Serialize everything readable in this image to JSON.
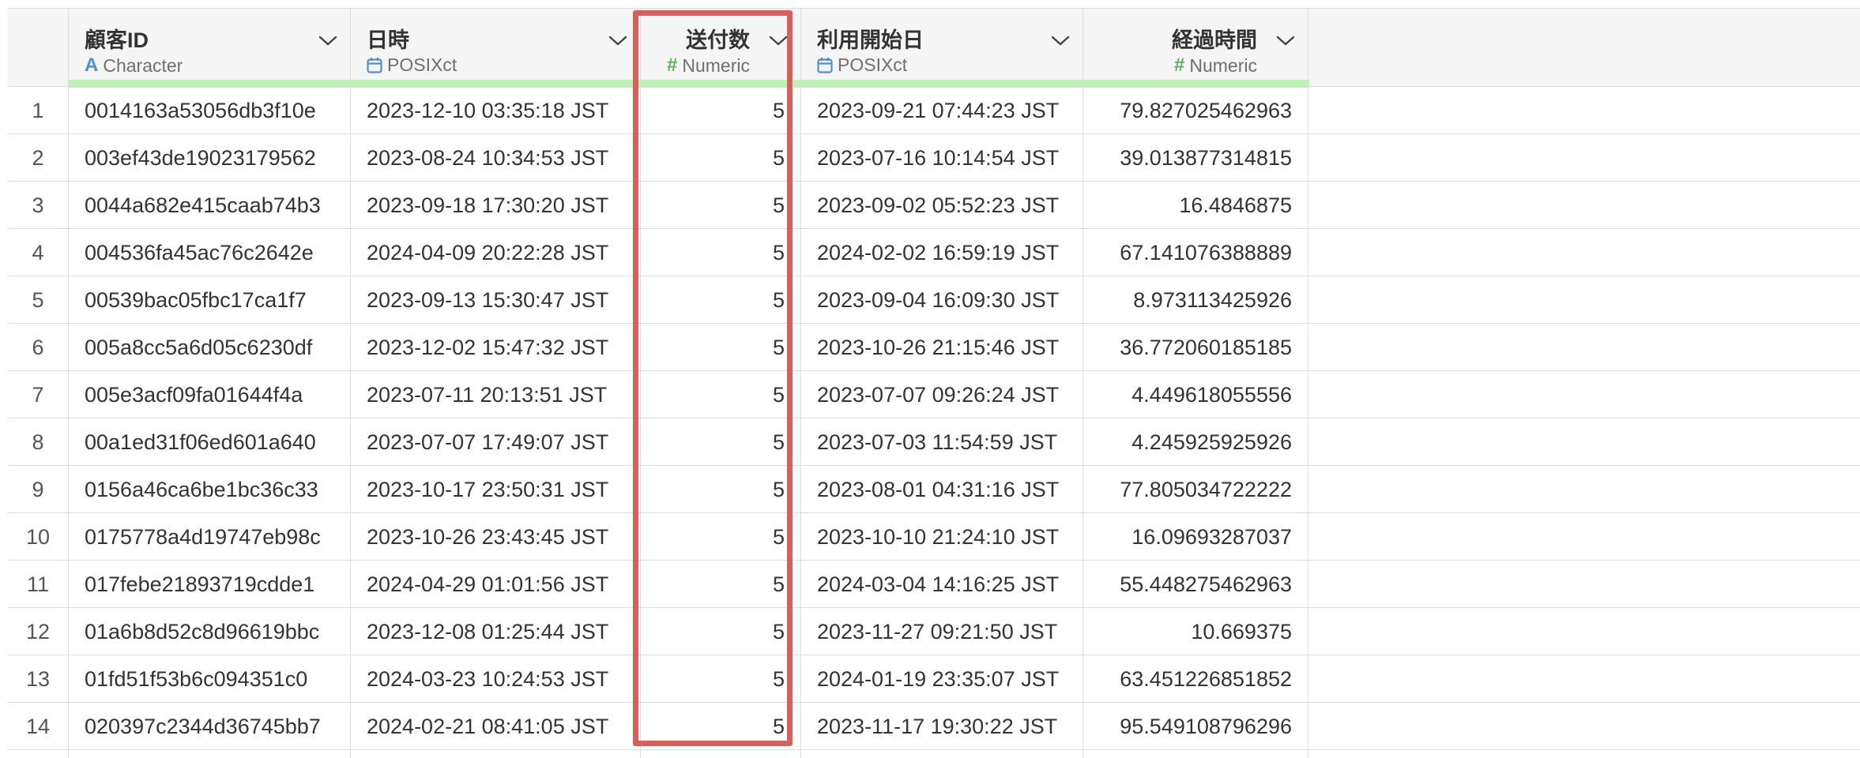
{
  "table": {
    "columns": [
      {
        "key": "customer_id",
        "name": "顧客ID",
        "type": "Character",
        "type_icon": "character-type-icon",
        "align": "left"
      },
      {
        "key": "datetime",
        "name": "日時",
        "type": "POSIXct",
        "type_icon": "calendar-icon",
        "align": "left"
      },
      {
        "key": "send_count",
        "name": "送付数",
        "type": "Numeric",
        "type_icon": "numeric-type-icon",
        "align": "right"
      },
      {
        "key": "start_date",
        "name": "利用開始日",
        "type": "POSIXct",
        "type_icon": "calendar-icon",
        "align": "left"
      },
      {
        "key": "elapsed",
        "name": "経過時間",
        "type": "Numeric",
        "type_icon": "numeric-type-icon",
        "align": "right"
      }
    ],
    "rows": [
      {
        "index": "1",
        "customer_id": "0014163a53056db3f10e",
        "datetime": "2023-12-10 03:35:18 JST",
        "send_count": "5",
        "start_date": "2023-09-21 07:44:23 JST",
        "elapsed": "79.827025462963"
      },
      {
        "index": "2",
        "customer_id": "003ef43de19023179562",
        "datetime": "2023-08-24 10:34:53 JST",
        "send_count": "5",
        "start_date": "2023-07-16 10:14:54 JST",
        "elapsed": "39.013877314815"
      },
      {
        "index": "3",
        "customer_id": "0044a682e415caab74b3",
        "datetime": "2023-09-18 17:30:20 JST",
        "send_count": "5",
        "start_date": "2023-09-02 05:52:23 JST",
        "elapsed": "16.4846875"
      },
      {
        "index": "4",
        "customer_id": "004536fa45ac76c2642e",
        "datetime": "2024-04-09 20:22:28 JST",
        "send_count": "5",
        "start_date": "2024-02-02 16:59:19 JST",
        "elapsed": "67.141076388889"
      },
      {
        "index": "5",
        "customer_id": "00539bac05fbc17ca1f7",
        "datetime": "2023-09-13 15:30:47 JST",
        "send_count": "5",
        "start_date": "2023-09-04 16:09:30 JST",
        "elapsed": "8.973113425926"
      },
      {
        "index": "6",
        "customer_id": "005a8cc5a6d05c6230df",
        "datetime": "2023-12-02 15:47:32 JST",
        "send_count": "5",
        "start_date": "2023-10-26 21:15:46 JST",
        "elapsed": "36.772060185185"
      },
      {
        "index": "7",
        "customer_id": "005e3acf09fa01644f4a",
        "datetime": "2023-07-11 20:13:51 JST",
        "send_count": "5",
        "start_date": "2023-07-07 09:26:24 JST",
        "elapsed": "4.449618055556"
      },
      {
        "index": "8",
        "customer_id": "00a1ed31f06ed601a640",
        "datetime": "2023-07-07 17:49:07 JST",
        "send_count": "5",
        "start_date": "2023-07-03 11:54:59 JST",
        "elapsed": "4.245925925926"
      },
      {
        "index": "9",
        "customer_id": "0156a46ca6be1bc36c33",
        "datetime": "2023-10-17 23:50:31 JST",
        "send_count": "5",
        "start_date": "2023-08-01 04:31:16 JST",
        "elapsed": "77.805034722222"
      },
      {
        "index": "10",
        "customer_id": "0175778a4d19747eb98c",
        "datetime": "2023-10-26 23:43:45 JST",
        "send_count": "5",
        "start_date": "2023-10-10 21:24:10 JST",
        "elapsed": "16.09693287037"
      },
      {
        "index": "11",
        "customer_id": "017febe21893719cdde1",
        "datetime": "2024-04-29 01:01:56 JST",
        "send_count": "5",
        "start_date": "2024-03-04 14:16:25 JST",
        "elapsed": "55.448275462963"
      },
      {
        "index": "12",
        "customer_id": "01a6b8d52c8d96619bbc",
        "datetime": "2023-12-08 01:25:44 JST",
        "send_count": "5",
        "start_date": "2023-11-27 09:21:50 JST",
        "elapsed": "10.669375"
      },
      {
        "index": "13",
        "customer_id": "01fd51f53b6c094351c0",
        "datetime": "2024-03-23 10:24:53 JST",
        "send_count": "5",
        "start_date": "2024-01-19 23:35:07 JST",
        "elapsed": "63.451226851852"
      },
      {
        "index": "14",
        "customer_id": "020397c2344d36745bb7",
        "datetime": "2024-02-21 08:41:05 JST",
        "send_count": "5",
        "start_date": "2023-11-17 19:30:22 JST",
        "elapsed": "95.549108796296"
      }
    ]
  },
  "highlight": {
    "column": "send_count",
    "color": "#d9605a"
  },
  "colors": {
    "header_bg": "#f5f5f5",
    "grid_line": "#dddddd",
    "quality_bar": "#bff0b7",
    "character_icon": "#4f8fd0",
    "numeric_icon": "#5db15b",
    "calendar_icon": "#4f8fd0"
  }
}
